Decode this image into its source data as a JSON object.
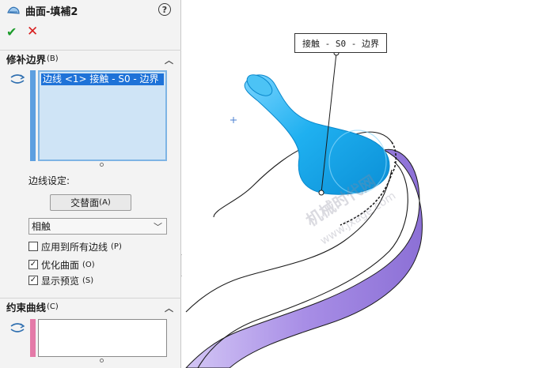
{
  "panel": {
    "title": "曲面-填補2",
    "help_label": "?",
    "ok_label": "✔",
    "cancel_label": "✕",
    "patch_boundary": {
      "heading": "修补边界",
      "heading_hint": "(B)",
      "items": [
        "边线 <1> 接触 - S0 - 边界"
      ],
      "edge_settings_label": "边线设定:",
      "alternate_face_button": "交替面",
      "alternate_face_hint": "(A)",
      "condition_value": "相触",
      "apply_all_edges": {
        "label": "应用到所有边线",
        "hint": "(P)",
        "checked": false
      },
      "optimize_surface": {
        "label": "优化曲面",
        "hint": "(O)",
        "checked": true
      },
      "show_preview": {
        "label": "显示预览",
        "hint": "(S)",
        "checked": true
      }
    },
    "constraint_curves": {
      "heading": "约束曲线",
      "heading_hint": "(C)"
    }
  },
  "viewport": {
    "callout_text": "接触 - S0 - 边界",
    "watermark_cn": "机械时代网",
    "watermark_url": "www.jxage.com"
  },
  "colors": {
    "selection_highlight": "#1e72d8",
    "preview_surface": "#1fb0f0",
    "model_side": "#a88ee6",
    "ok_green": "#1c9c2b",
    "cancel_red": "#d81e1e"
  }
}
